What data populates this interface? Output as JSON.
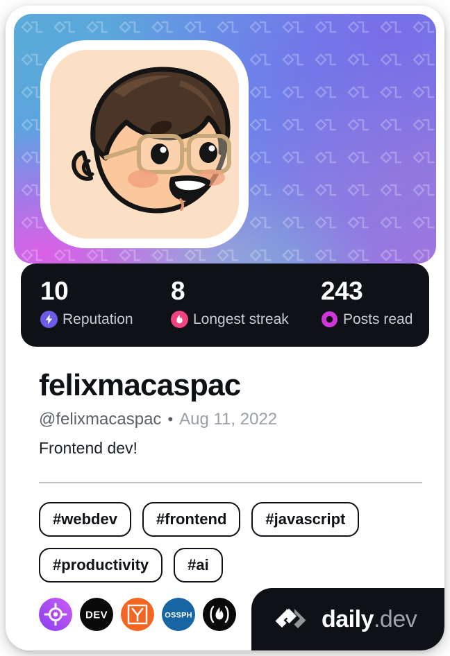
{
  "card": {
    "cover": {
      "pattern_icon": "daily-dev-chevron-watermark"
    },
    "avatar": {
      "icon": "user-avatar-illustration",
      "alt": "Cartoon avatar of a person with brown hair and glasses smiling"
    }
  },
  "stats": [
    {
      "value": "10",
      "label": "Reputation",
      "icon": "reputation-bolt-icon",
      "color": "#6b5ce7"
    },
    {
      "value": "8",
      "label": "Longest streak",
      "icon": "streak-flame-icon",
      "color": "#f0437f"
    },
    {
      "value": "243",
      "label": "Posts read",
      "icon": "posts-read-ring-icon",
      "color": "#cf35d8"
    }
  ],
  "profile": {
    "display_name": "felixmacaspac",
    "handle": "@felixmacaspac",
    "separator": "•",
    "joined": "Aug 11, 2022",
    "bio": "Frontend dev!"
  },
  "tags": [
    {
      "label": "#webdev"
    },
    {
      "label": "#frontend"
    },
    {
      "label": "#javascript"
    },
    {
      "label": "#productivity"
    },
    {
      "label": "#ai"
    }
  ],
  "badges": [
    {
      "name": "purple-target-badge",
      "text": "",
      "bg": "#a742f0"
    },
    {
      "name": "dev-community-badge",
      "text": "DEV",
      "bg": "#0a0a0a"
    },
    {
      "name": "y-combinator-badge",
      "text": "Y",
      "bg": "#f26522"
    },
    {
      "name": "ossph-badge",
      "text": "OSSPH",
      "bg": "#1765a3"
    },
    {
      "name": "flame-badge",
      "text": "",
      "bg": "#0a0a0a"
    }
  ],
  "brand": {
    "logo_icon": "daily-dev-logo-icon",
    "name": "daily",
    "suffix": ".dev",
    "background": "#0e1217"
  }
}
